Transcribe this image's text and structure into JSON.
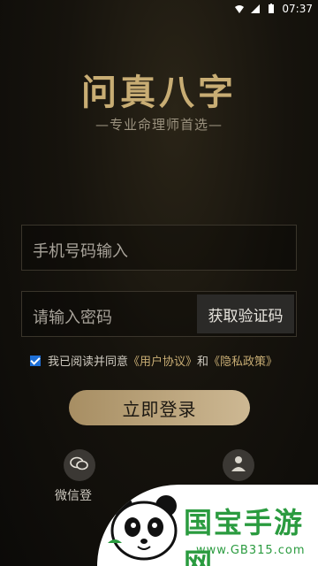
{
  "status_bar": {
    "time": "07:37"
  },
  "header": {
    "title": "问真八字",
    "subtitle": "—专业命理师首选—"
  },
  "form": {
    "phone_placeholder": "手机号码输入",
    "password_placeholder": "请输入密码",
    "get_code_label": "获取验证码"
  },
  "agreement": {
    "prefix": "我已阅读并同意",
    "user_agreement": "《用户协议》",
    "and": "和",
    "privacy_policy": "《隐私政策》"
  },
  "login_button": "立即登录",
  "social": {
    "wechat_label": "微信登"
  },
  "watermark": {
    "brand": "国宝手游网",
    "url": "www.GB315.com"
  }
}
